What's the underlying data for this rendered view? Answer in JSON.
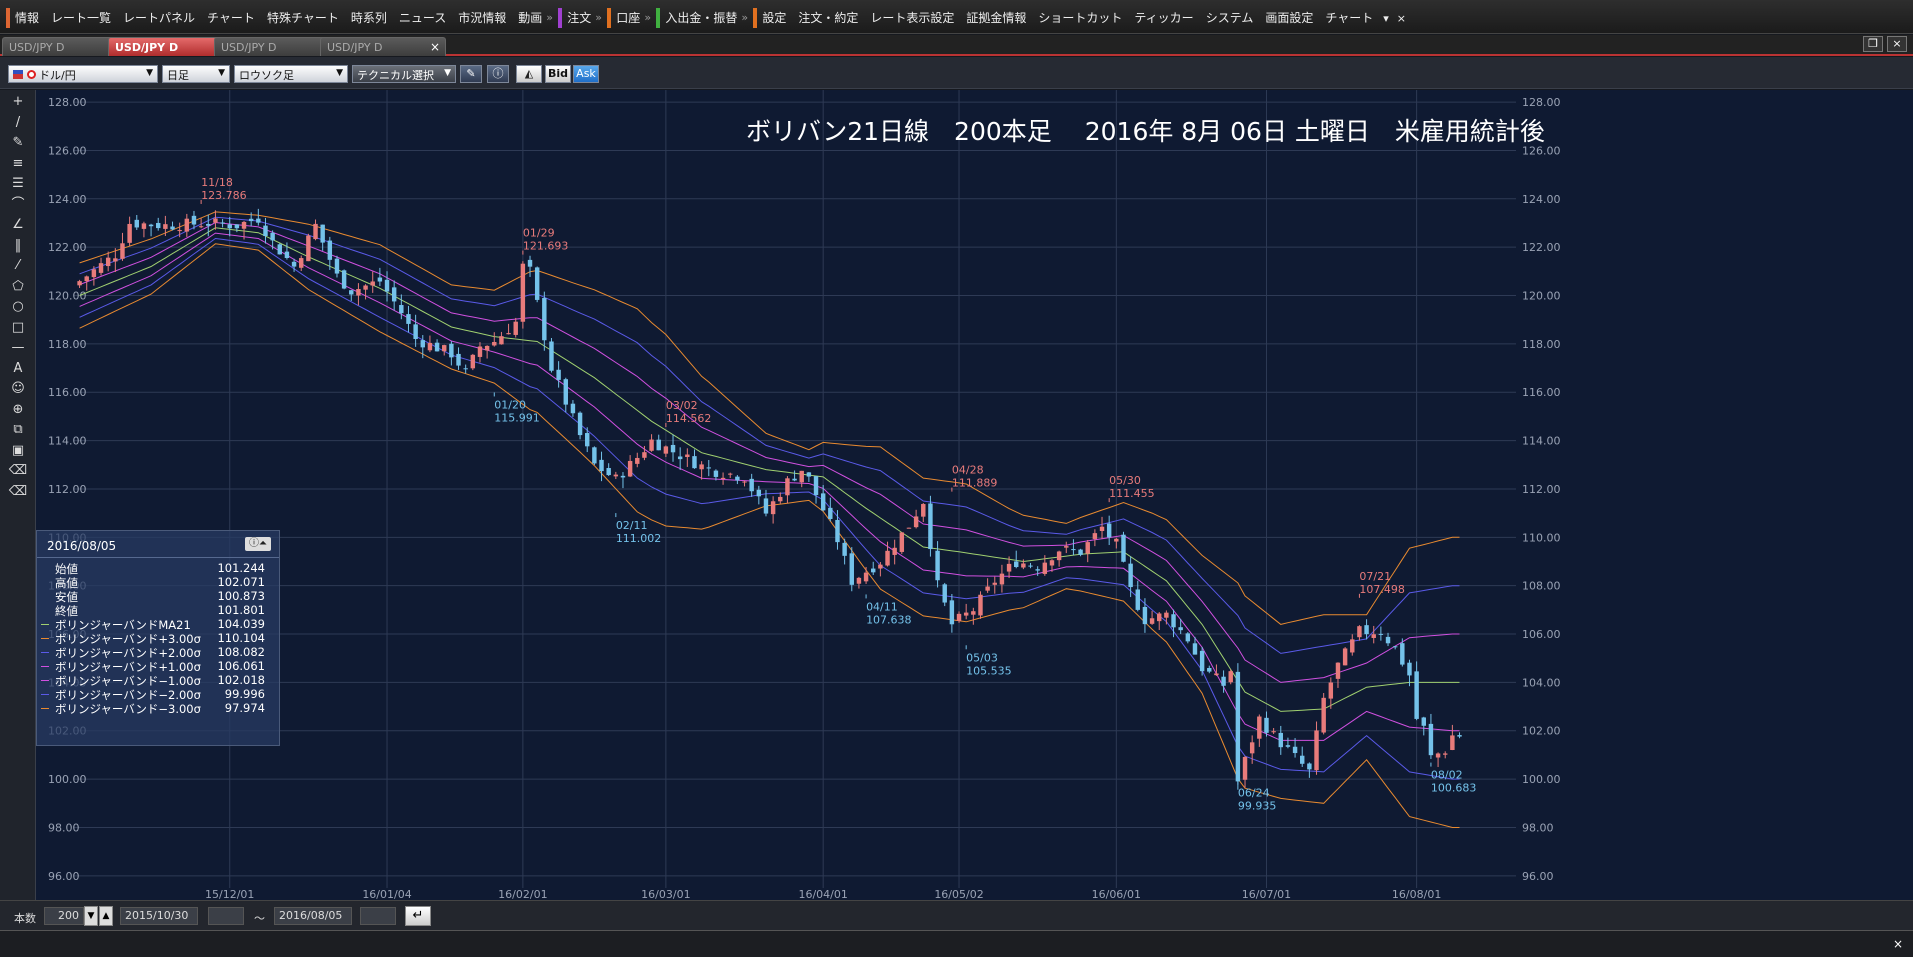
{
  "menu": {
    "items": [
      {
        "label": "情報",
        "marker": "#d63"
      },
      {
        "label": "レート一覧"
      },
      {
        "label": "レートパネル"
      },
      {
        "label": "チャート"
      },
      {
        "label": "特殊チャート"
      },
      {
        "label": "時系列"
      },
      {
        "label": "ニュース"
      },
      {
        "label": "市況情報"
      },
      {
        "label": "動画"
      },
      {
        "label": "注文",
        "marker": "#a040d0"
      },
      {
        "label": "口座",
        "marker": "#e07020"
      },
      {
        "label": "入出金・振替",
        "marker": "#40b040"
      },
      {
        "label": "設定",
        "marker": "#e07020"
      },
      {
        "label": "注文・約定"
      },
      {
        "label": "レート表示設定"
      },
      {
        "label": "証拠金情報"
      },
      {
        "label": "ショートカット"
      },
      {
        "label": "ティッカー"
      },
      {
        "label": "システム"
      },
      {
        "label": "画面設定"
      },
      {
        "label": "チャート"
      }
    ],
    "dropdown_glyph": "▾",
    "close_glyph": "×"
  },
  "tabs": [
    {
      "label": "USD/JPY D",
      "active": false
    },
    {
      "label": "USD/JPY D",
      "active": true
    },
    {
      "label": "USD/JPY D",
      "active": false
    },
    {
      "label": "USD/JPY D",
      "active": false
    }
  ],
  "tab_close": "×",
  "window": {
    "restore": "❐",
    "close": "×"
  },
  "toolbar": {
    "symbol": "ドル/円",
    "timeframe": "日足",
    "chart_type": "ロウソク足",
    "technical": "テクニカル選択",
    "bid": "Bid",
    "ask": "Ask"
  },
  "tools": [
    "+",
    "/",
    "✎",
    "≡",
    "☰",
    "⌒",
    "∠",
    "‖",
    "⁄",
    "⬠",
    "○",
    "□",
    "—",
    "A",
    "☺",
    "⊕",
    "⧉",
    "▣",
    "⌫",
    "⌫"
  ],
  "chart_title": "ボリバン21日線　200本足　 2016年 8月 06日 土曜日　米雇用統計後",
  "chart_data": {
    "type": "candlestick",
    "ylim": [
      95,
      128.5
    ],
    "ticks_y": [
      96,
      98,
      100,
      102,
      104,
      106,
      108,
      110,
      112,
      114,
      116,
      118,
      120,
      122,
      124,
      126,
      128
    ],
    "xaxis_labels": [
      {
        "label": "15/12/01",
        "i": 21
      },
      {
        "label": "16/01/04",
        "i": 43
      },
      {
        "label": "16/02/01",
        "i": 62
      },
      {
        "label": "16/03/01",
        "i": 82
      },
      {
        "label": "16/04/01",
        "i": 104
      },
      {
        "label": "16/05/02",
        "i": 123
      },
      {
        "label": "16/06/01",
        "i": 145
      },
      {
        "label": "16/07/01",
        "i": 166
      },
      {
        "label": "16/08/01",
        "i": 187
      }
    ],
    "n_bars": 200,
    "close_path": [
      [
        0,
        120.6
      ],
      [
        5,
        121.7
      ],
      [
        7,
        123.0
      ],
      [
        12,
        122.9
      ],
      [
        18,
        123.0
      ],
      [
        22,
        122.9
      ],
      [
        25,
        123.2
      ],
      [
        27,
        122.2
      ],
      [
        30,
        121.2
      ],
      [
        33,
        122.9
      ],
      [
        36,
        120.8
      ],
      [
        38,
        120.2
      ],
      [
        42,
        120.6
      ],
      [
        45,
        119.3
      ],
      [
        47,
        118.2
      ],
      [
        52,
        117.6
      ],
      [
        54,
        116.8
      ],
      [
        56,
        117.9
      ],
      [
        58,
        118.1
      ],
      [
        61,
        118.9
      ],
      [
        62,
        121.2
      ],
      [
        63,
        121.0
      ],
      [
        66,
        117.0
      ],
      [
        70,
        114.2
      ],
      [
        72,
        113.0
      ],
      [
        75,
        112.4
      ],
      [
        78,
        113.3
      ],
      [
        80,
        114.0
      ],
      [
        84,
        113.4
      ],
      [
        88,
        112.8
      ],
      [
        93,
        112.5
      ],
      [
        96,
        111.0
      ],
      [
        99,
        112.3
      ],
      [
        101,
        112.8
      ],
      [
        102,
        112.4
      ],
      [
        106,
        109.9
      ],
      [
        108,
        108.2
      ],
      [
        112,
        109.0
      ],
      [
        116,
        110.5
      ],
      [
        118,
        111.5
      ],
      [
        120,
        108.0
      ],
      [
        122,
        106.4
      ],
      [
        125,
        107.0
      ],
      [
        128,
        108.2
      ],
      [
        131,
        109.0
      ],
      [
        134,
        108.8
      ],
      [
        137,
        109.5
      ],
      [
        140,
        109.4
      ],
      [
        143,
        110.4
      ],
      [
        145,
        109.7
      ],
      [
        147,
        107.8
      ],
      [
        149,
        106.6
      ],
      [
        152,
        106.8
      ],
      [
        155,
        105.8
      ],
      [
        157,
        104.6
      ],
      [
        160,
        103.9
      ],
      [
        161,
        104.5
      ],
      [
        162,
        99.9
      ],
      [
        165,
        102.5
      ],
      [
        167,
        101.8
      ],
      [
        169,
        101.2
      ],
      [
        171,
        100.6
      ],
      [
        172,
        100.3
      ],
      [
        174,
        103.3
      ],
      [
        176,
        104.7
      ],
      [
        179,
        106.1
      ],
      [
        182,
        106.1
      ],
      [
        184,
        105.4
      ],
      [
        186,
        104.3
      ],
      [
        187,
        102.5
      ],
      [
        188,
        102.1
      ],
      [
        189,
        100.9
      ],
      [
        191,
        101.2
      ],
      [
        192,
        101.8
      ]
    ],
    "ma21_path": [
      [
        0,
        120.0
      ],
      [
        10,
        121.2
      ],
      [
        19,
        122.8
      ],
      [
        25,
        122.6
      ],
      [
        32,
        121.6
      ],
      [
        42,
        120.3
      ],
      [
        52,
        118.7
      ],
      [
        58,
        118.3
      ],
      [
        64,
        118.1
      ],
      [
        72,
        116.6
      ],
      [
        80,
        114.8
      ],
      [
        87,
        113.5
      ],
      [
        96,
        112.8
      ],
      [
        104,
        112.5
      ],
      [
        110,
        111.2
      ],
      [
        118,
        109.6
      ],
      [
        123,
        109.4
      ],
      [
        132,
        109.0
      ],
      [
        140,
        109.3
      ],
      [
        146,
        109.4
      ],
      [
        152,
        108.2
      ],
      [
        157,
        106.4
      ],
      [
        163,
        103.6
      ],
      [
        168,
        102.8
      ],
      [
        174,
        102.9
      ],
      [
        180,
        103.8
      ],
      [
        186,
        104.0
      ],
      [
        192,
        104.0
      ]
    ],
    "sigma_width_path": [
      [
        0,
        0.45
      ],
      [
        10,
        0.38
      ],
      [
        19,
        0.22
      ],
      [
        25,
        0.24
      ],
      [
        32,
        0.45
      ],
      [
        42,
        0.6
      ],
      [
        52,
        0.58
      ],
      [
        58,
        0.64
      ],
      [
        63,
        0.95
      ],
      [
        70,
        1.15
      ],
      [
        78,
        1.4
      ],
      [
        82,
        1.32
      ],
      [
        88,
        1.0
      ],
      [
        96,
        0.5
      ],
      [
        102,
        0.35
      ],
      [
        106,
        0.6
      ],
      [
        112,
        0.98
      ],
      [
        118,
        0.95
      ],
      [
        124,
        0.95
      ],
      [
        130,
        0.7
      ],
      [
        138,
        0.45
      ],
      [
        145,
        0.65
      ],
      [
        150,
        0.8
      ],
      [
        157,
        0.95
      ],
      [
        162,
        1.35
      ],
      [
        168,
        1.2
      ],
      [
        174,
        1.3
      ],
      [
        180,
        1.0
      ],
      [
        186,
        1.85
      ],
      [
        192,
        2.0
      ]
    ],
    "annotations": [
      {
        "i": 17,
        "date": "11/18",
        "value": "123.786",
        "price": 123.786,
        "pos": "high"
      },
      {
        "i": 58,
        "date": "01/20",
        "value": "115.991",
        "price": 115.991,
        "pos": "low"
      },
      {
        "i": 62,
        "date": "01/29",
        "value": "121.693",
        "price": 121.693,
        "pos": "high"
      },
      {
        "i": 75,
        "date": "02/11",
        "value": "111.002",
        "price": 111.002,
        "pos": "low"
      },
      {
        "i": 82,
        "date": "03/02",
        "value": "114.562",
        "price": 114.562,
        "pos": "high"
      },
      {
        "i": 110,
        "date": "04/11",
        "value": "107.638",
        "price": 107.638,
        "pos": "low"
      },
      {
        "i": 122,
        "date": "04/28",
        "value": "111.889",
        "price": 111.889,
        "pos": "high"
      },
      {
        "i": 124,
        "date": "05/03",
        "value": "105.535",
        "price": 105.535,
        "pos": "low"
      },
      {
        "i": 144,
        "date": "05/30",
        "value": "111.455",
        "price": 111.455,
        "pos": "high"
      },
      {
        "i": 162,
        "date": "06/24",
        "value": "99.935",
        "price": 99.935,
        "pos": "low"
      },
      {
        "i": 179,
        "date": "07/21",
        "value": "107.498",
        "price": 107.498,
        "pos": "high"
      },
      {
        "i": 189,
        "date": "08/02",
        "value": "100.683",
        "price": 100.683,
        "pos": "low"
      }
    ],
    "colors": {
      "up": "#e87b7b",
      "down": "#74c2ea",
      "grid": "#2e3a55",
      "ma": "#a0d070",
      "s1": "#d050e0",
      "s2": "#5a5ae8",
      "s3": "#e88a30",
      "axis_text": "#9aa3b5",
      "ann_high": "#e87b7b",
      "ann_low": "#74c2ea",
      "bg": "#0f1a32"
    }
  },
  "info": {
    "date": "2016/08/05",
    "icon": "ⓘ⏶",
    "rows": [
      {
        "label": "始値",
        "value": "101.244"
      },
      {
        "label": "高値",
        "value": "102.071"
      },
      {
        "label": "安値",
        "value": "100.873"
      },
      {
        "label": "終値",
        "value": "101.801"
      },
      {
        "label": "ボリンジャーバンドMA21",
        "value": "104.039",
        "color": "#a0d070"
      },
      {
        "label": "ボリンジャーバンド+3.00σ",
        "value": "110.104",
        "color": "#e88a30"
      },
      {
        "label": "ボリンジャーバンド+2.00σ",
        "value": "108.082",
        "color": "#5a5ae8"
      },
      {
        "label": "ボリンジャーバンド+1.00σ",
        "value": "106.061",
        "color": "#d050e0"
      },
      {
        "label": "ボリンジャーバンド−1.00σ",
        "value": "102.018",
        "color": "#d050e0"
      },
      {
        "label": "ボリンジャーバンド−2.00σ",
        "value": "99.996",
        "color": "#5a5ae8"
      },
      {
        "label": "ボリンジャーバンド−3.00σ",
        "value": "97.974",
        "color": "#e88a30"
      }
    ]
  },
  "status": {
    "count_label": "本数",
    "count_value": "200",
    "from_date": "2015/10/30",
    "tilde": "〜",
    "to_date": "2016/08/05",
    "go": "↵"
  },
  "bottom_close": "×"
}
